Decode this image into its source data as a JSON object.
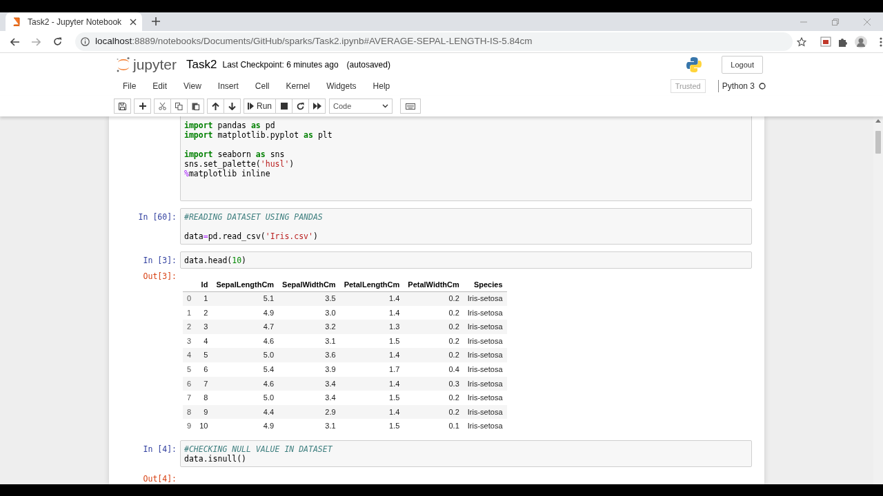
{
  "browser": {
    "tab_title": "Task2 - Jupyter Notebook",
    "url_host": "localhost",
    "url_rest": ":8889/notebooks/Documents/GitHub/sparks/Task2.ipynb#AVERAGE-SEPAL-LENGTH-IS-5.84cm"
  },
  "header": {
    "logo_text": "jupyter",
    "notebook_name": "Task2",
    "checkpoint": "Last Checkpoint: 6 minutes ago",
    "autosave": "(autosaved)",
    "logout": "Logout"
  },
  "menu": [
    "File",
    "Edit",
    "View",
    "Insert",
    "Cell",
    "Kernel",
    "Widgets",
    "Help"
  ],
  "trusted": "Trusted",
  "kernel": {
    "name": "Python 3",
    "busy": false
  },
  "toolbar": {
    "run": "Run",
    "cell_type": "Code"
  },
  "cells": [
    {
      "lines": [
        {
          "tokens": [
            {
              "kind": "keyword",
              "text": "import"
            },
            {
              "kind": "plain",
              "text": " pandas "
            },
            {
              "kind": "keyword",
              "text": "as"
            },
            {
              "kind": "plain",
              "text": " pd"
            }
          ]
        },
        {
          "tokens": [
            {
              "kind": "keyword",
              "text": "import"
            },
            {
              "kind": "plain",
              "text": " matplotlib.pyplot "
            },
            {
              "kind": "keyword",
              "text": "as"
            },
            {
              "kind": "plain",
              "text": " plt"
            }
          ]
        },
        {
          "blank": true
        },
        {
          "tokens": [
            {
              "kind": "keyword",
              "text": "import"
            },
            {
              "kind": "plain",
              "text": " seaborn "
            },
            {
              "kind": "keyword",
              "text": "as"
            },
            {
              "kind": "plain",
              "text": " sns"
            }
          ]
        },
        {
          "tokens": [
            {
              "kind": "plain",
              "text": "sns.set_palette("
            },
            {
              "kind": "string",
              "text": "'husl'"
            },
            {
              "kind": "plain",
              "text": ")"
            }
          ]
        },
        {
          "tokens": [
            {
              "kind": "magic",
              "text": "%"
            },
            {
              "kind": "plain",
              "text": "matplotlib inline"
            }
          ]
        },
        {
          "blank": true
        },
        {
          "blank": true
        }
      ]
    },
    {
      "prompt": "In [60]:",
      "lines": [
        {
          "tokens": [
            {
              "kind": "comment",
              "text": "#READING DATASET USING PANDAS"
            }
          ]
        },
        {
          "blank": true
        },
        {
          "tokens": [
            {
              "kind": "plain",
              "text": "data"
            },
            {
              "kind": "operator",
              "text": "="
            },
            {
              "kind": "plain",
              "text": "pd.read_csv("
            },
            {
              "kind": "string",
              "text": "'Iris.csv'"
            },
            {
              "kind": "plain",
              "text": ")"
            }
          ]
        }
      ]
    },
    {
      "prompt": "In [3]:",
      "lines": [
        {
          "tokens": [
            {
              "kind": "plain",
              "text": "data.head("
            },
            {
              "kind": "number",
              "text": "10"
            },
            {
              "kind": "plain",
              "text": ")"
            }
          ]
        }
      ],
      "output": {
        "prompt": "Out[3]:",
        "table": {
          "columns": [
            "Id",
            "SepalLengthCm",
            "SepalWidthCm",
            "PetalLengthCm",
            "PetalWidthCm",
            "Species"
          ],
          "rows": [
            {
              "index": "0",
              "cells": [
                "1",
                "5.1",
                "3.5",
                "1.4",
                "0.2",
                "Iris-setosa"
              ]
            },
            {
              "index": "1",
              "cells": [
                "2",
                "4.9",
                "3.0",
                "1.4",
                "0.2",
                "Iris-setosa"
              ]
            },
            {
              "index": "2",
              "cells": [
                "3",
                "4.7",
                "3.2",
                "1.3",
                "0.2",
                "Iris-setosa"
              ]
            },
            {
              "index": "3",
              "cells": [
                "4",
                "4.6",
                "3.1",
                "1.5",
                "0.2",
                "Iris-setosa"
              ]
            },
            {
              "index": "4",
              "cells": [
                "5",
                "5.0",
                "3.6",
                "1.4",
                "0.2",
                "Iris-setosa"
              ]
            },
            {
              "index": "5",
              "cells": [
                "6",
                "5.4",
                "3.9",
                "1.7",
                "0.4",
                "Iris-setosa"
              ]
            },
            {
              "index": "6",
              "cells": [
                "7",
                "4.6",
                "3.4",
                "1.4",
                "0.3",
                "Iris-setosa"
              ]
            },
            {
              "index": "7",
              "cells": [
                "8",
                "5.0",
                "3.4",
                "1.5",
                "0.2",
                "Iris-setosa"
              ]
            },
            {
              "index": "8",
              "cells": [
                "9",
                "4.4",
                "2.9",
                "1.4",
                "0.2",
                "Iris-setosa"
              ]
            },
            {
              "index": "9",
              "cells": [
                "10",
                "4.9",
                "3.1",
                "1.5",
                "0.1",
                "Iris-setosa"
              ]
            }
          ]
        }
      }
    },
    {
      "prompt": "In [4]:",
      "lines": [
        {
          "tokens": [
            {
              "kind": "comment",
              "text": "#CHECKING NULL VALUE IN DATASET"
            }
          ]
        },
        {
          "tokens": [
            {
              "kind": "plain",
              "text": "data.isnull()"
            }
          ]
        }
      ],
      "output": {
        "prompt": "Out[4]:"
      }
    }
  ]
}
